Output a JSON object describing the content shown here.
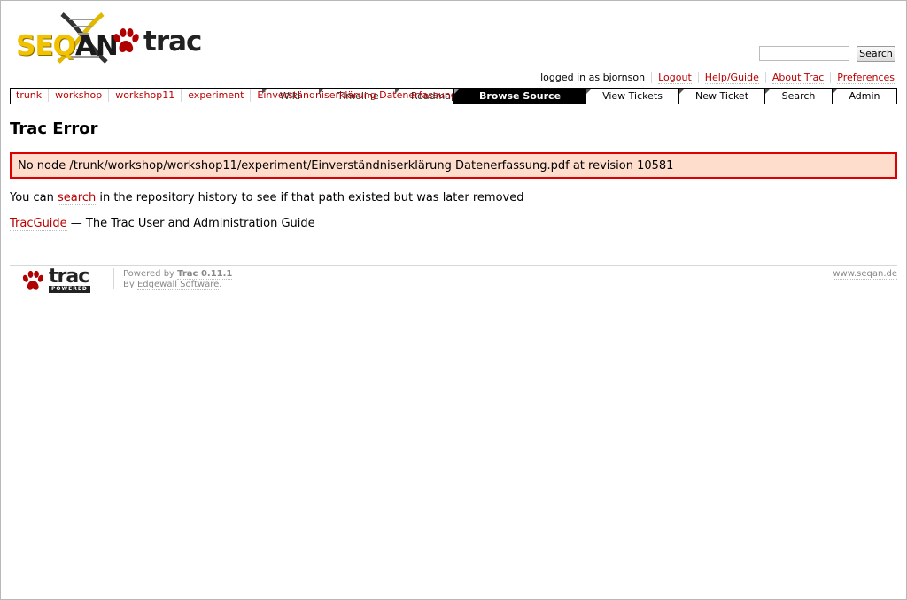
{
  "logo": {
    "seq": "SEQ",
    "an": "AN",
    "trac": "trac"
  },
  "search": {
    "placeholder": "",
    "button_label": "Search"
  },
  "metanav": {
    "logged_in": "logged in as bjornson",
    "links": [
      "Logout",
      "Help/Guide",
      "About Trac",
      "Preferences"
    ]
  },
  "mainnav": {
    "tabs": [
      "Browse Source",
      "View Tickets",
      "New Ticket",
      "Search",
      "Admin"
    ],
    "active": "Browse Source",
    "hidden_tabs": [
      "Wiki",
      "Timeline",
      "Roadmap"
    ]
  },
  "breadcrumbs": [
    "trunk",
    "workshop",
    "workshop11",
    "experiment",
    "Einverständniserklärung Datenerfassung.pdf"
  ],
  "content": {
    "title": "Trac Error",
    "error_message": "No node /trunk/workshop/workshop11/experiment/Einverständniserklärung Datenerfassung.pdf at revision 10581",
    "hint_prefix": "You can ",
    "hint_link": "search",
    "hint_suffix": " in the repository history to see if that path existed but was later removed",
    "guide_link": "TracGuide",
    "guide_suffix": " — The Trac User and Administration Guide"
  },
  "footer": {
    "logo_text": "trac",
    "powered_badge": "POWERED",
    "powered_by": "Powered by ",
    "trac_version": "Trac 0.11.1",
    "by": "By ",
    "company": "Edgewall Software",
    "company_suffix": ".",
    "site": "www.seqan.de"
  },
  "colors": {
    "link": "#bb0000",
    "error_bg": "#ffddcc",
    "error_border": "#dd0000",
    "active_tab": "#000000",
    "logo_yellow": "#f2c200"
  }
}
